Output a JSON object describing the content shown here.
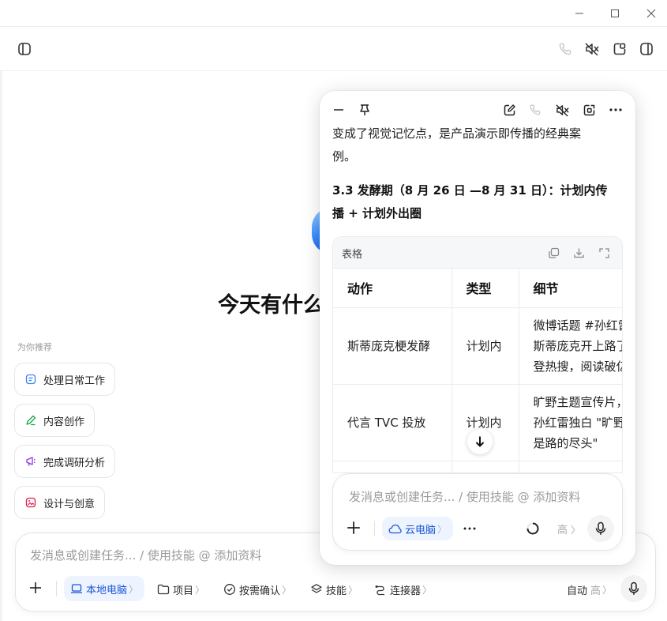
{
  "main": {
    "greeting": "今天有什么",
    "recommend_title": "为你推荐",
    "chips": [
      {
        "label": "处理日常工作",
        "icon": "checklist-icon",
        "color": "#3b82f6"
      },
      {
        "label": "内容创作",
        "icon": "pen-icon",
        "color": "#16a34a"
      },
      {
        "label": "完成调研分析",
        "icon": "megaphone-icon",
        "color": "#9333ea"
      },
      {
        "label": "设计与创意",
        "icon": "image-icon",
        "color": "#e11d48"
      }
    ]
  },
  "composer": {
    "placeholder": "发消息或创建任务... / 使用技能 @ 添加资料",
    "tools": {
      "local_pc": "本地电脑",
      "project": "项目",
      "confirm": "按需确认",
      "skills": "技能",
      "connectors": "连接器"
    },
    "mode_auto": "自动",
    "mode_level": "高",
    "chevron": "〉"
  },
  "panel": {
    "text_lines": [
      "变成了视觉记忆点，是产品演示即传播的经典案",
      "例。"
    ],
    "heading_lines": [
      "3.3 发酵期（8 月 26 日 —8 月 31 日）：计划内传",
      "播 + 计划外出圈"
    ],
    "table": {
      "title": "表格",
      "headers": [
        "动作",
        "类型",
        "细节"
      ],
      "rows": [
        {
          "action": "斯蒂庞克梗发酵",
          "type": "计划内",
          "detail": [
            "微博话题 #孙红雷",
            "斯蒂庞克开上路了",
            "登热搜，阅读破亿"
          ]
        },
        {
          "action": "代言 TVC 投放",
          "type": "计划内",
          "detail": [
            "旷野主题宣传片，",
            "孙红雷独白 \"旷野",
            "是路的尽头\""
          ]
        }
      ]
    },
    "composer_placeholder": "发消息或创建任务... / 使用技能 @ 添加资料",
    "cloud_pc": "云电脑",
    "level": "高"
  },
  "colors": {
    "accent": "#1a56d6",
    "accent_bg": "#eef4ff"
  }
}
